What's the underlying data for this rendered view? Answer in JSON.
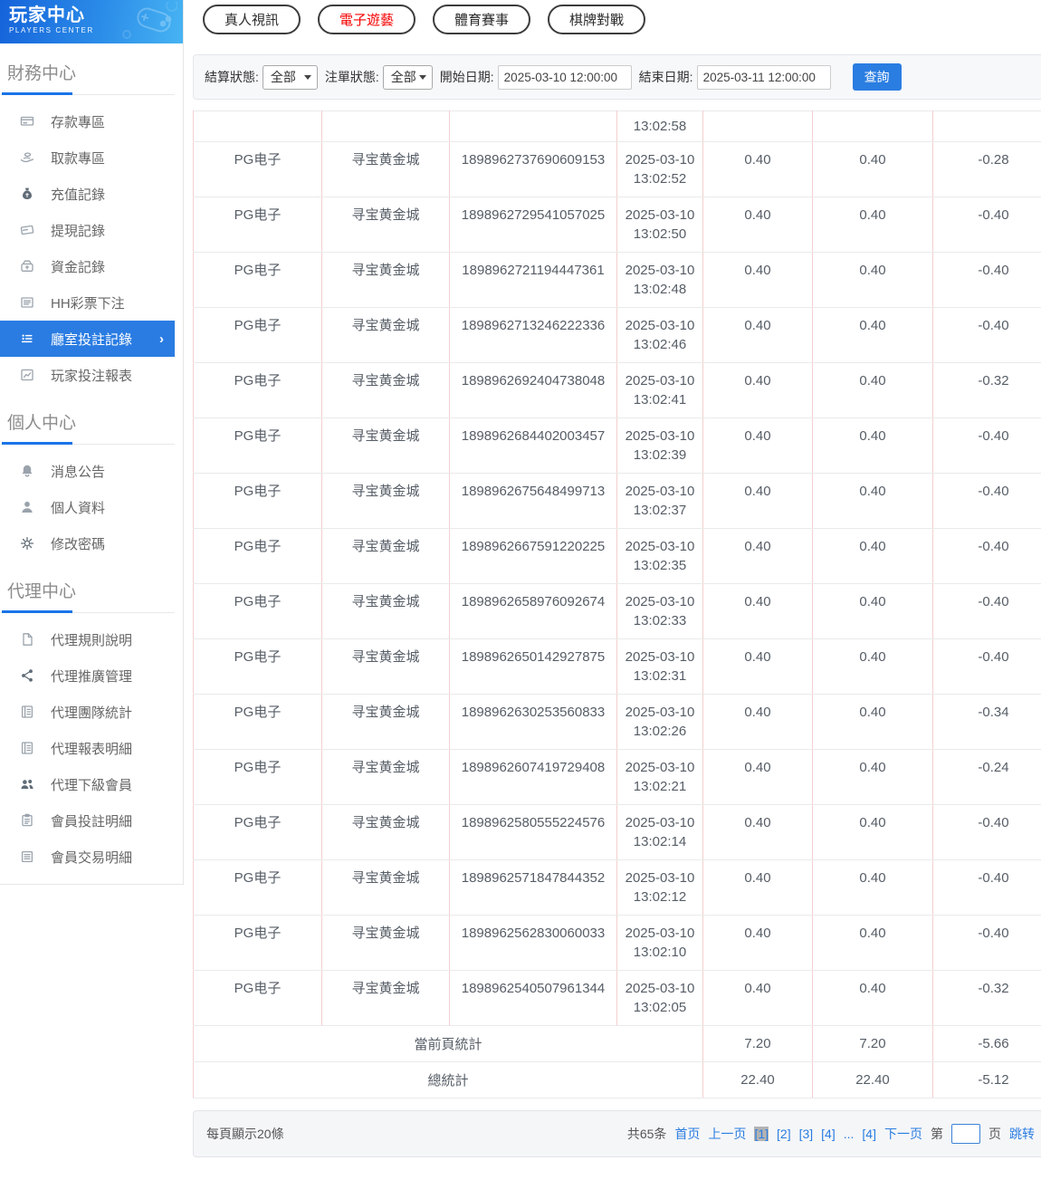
{
  "colors": {
    "accent_blue": "#2a7de1",
    "sidebar_selected_bg": "#2a7ce2",
    "active_tab_text": "#f50000",
    "table_vertical_border": "#f3cfcf",
    "table_horizontal_border": "#eaeaea",
    "current_page_bg": "#b3b3b3"
  },
  "sidebar": {
    "logo": {
      "title": "玩家中心",
      "subtitle": "PLAYERS CENTER"
    },
    "sections": [
      {
        "title": "財務中心",
        "items": [
          {
            "label": "存款專區",
            "icon": "deposit-icon",
            "selected": false
          },
          {
            "label": "取款專區",
            "icon": "withdraw-icon",
            "selected": false
          },
          {
            "label": "充值記錄",
            "icon": "recharge-record-icon",
            "selected": false
          },
          {
            "label": "提現記錄",
            "icon": "withdrawal-record-icon",
            "selected": false
          },
          {
            "label": "資金記錄",
            "icon": "funds-record-icon",
            "selected": false
          },
          {
            "label": "HH彩票下注",
            "icon": "lottery-bet-icon",
            "selected": false
          },
          {
            "label": "廳室投註記錄",
            "icon": "hall-bet-record-icon",
            "selected": true
          },
          {
            "label": "玩家投注報表",
            "icon": "player-bet-report-icon",
            "selected": false
          }
        ]
      },
      {
        "title": "個人中心",
        "items": [
          {
            "label": "消息公告",
            "icon": "notice-icon",
            "selected": false
          },
          {
            "label": "個人資料",
            "icon": "profile-icon",
            "selected": false
          },
          {
            "label": "修改密碼",
            "icon": "password-icon",
            "selected": false
          }
        ]
      },
      {
        "title": "代理中心",
        "items": [
          {
            "label": "代理規則說明",
            "icon": "agent-rules-icon",
            "selected": false
          },
          {
            "label": "代理推廣管理",
            "icon": "agent-promotion-icon",
            "selected": false
          },
          {
            "label": "代理團隊統計",
            "icon": "agent-team-stats-icon",
            "selected": false
          },
          {
            "label": "代理報表明細",
            "icon": "agent-report-detail-icon",
            "selected": false
          },
          {
            "label": "代理下級會員",
            "icon": "agent-sub-members-icon",
            "selected": false
          },
          {
            "label": "會員投註明細",
            "icon": "member-bet-detail-icon",
            "selected": false
          },
          {
            "label": "會員交易明細",
            "icon": "member-transaction-detail-icon",
            "selected": false
          }
        ]
      }
    ]
  },
  "tabs": [
    {
      "label": "真人視訊",
      "active": false
    },
    {
      "label": "電子遊藝",
      "active": true
    },
    {
      "label": "體育賽事",
      "active": false
    },
    {
      "label": "棋牌對戰",
      "active": false
    }
  ],
  "filters": {
    "settle_status_label": "結算狀態:",
    "settle_status_value": "全部",
    "order_status_label": "注單狀態:",
    "order_status_value": "全部",
    "start_date_label": "開始日期:",
    "start_date_value": "2025-03-10 12:00:00",
    "end_date_label": "結束日期:",
    "end_date_value": "2025-03-11 12:00:00",
    "search_label": "查詢"
  },
  "table": {
    "partial_row_time": "13:02:58",
    "rows": [
      {
        "platform": "PG电子",
        "game": "寻宝黄金城",
        "order_id": "1898962737690609153",
        "date": "2025-03-10",
        "time": "13:02:52",
        "bet": "0.40",
        "valid": "0.40",
        "profit": "-0.28"
      },
      {
        "platform": "PG电子",
        "game": "寻宝黄金城",
        "order_id": "1898962729541057025",
        "date": "2025-03-10",
        "time": "13:02:50",
        "bet": "0.40",
        "valid": "0.40",
        "profit": "-0.40"
      },
      {
        "platform": "PG电子",
        "game": "寻宝黄金城",
        "order_id": "1898962721194447361",
        "date": "2025-03-10",
        "time": "13:02:48",
        "bet": "0.40",
        "valid": "0.40",
        "profit": "-0.40"
      },
      {
        "platform": "PG电子",
        "game": "寻宝黄金城",
        "order_id": "1898962713246222336",
        "date": "2025-03-10",
        "time": "13:02:46",
        "bet": "0.40",
        "valid": "0.40",
        "profit": "-0.40"
      },
      {
        "platform": "PG电子",
        "game": "寻宝黄金城",
        "order_id": "1898962692404738048",
        "date": "2025-03-10",
        "time": "13:02:41",
        "bet": "0.40",
        "valid": "0.40",
        "profit": "-0.32"
      },
      {
        "platform": "PG电子",
        "game": "寻宝黄金城",
        "order_id": "1898962684402003457",
        "date": "2025-03-10",
        "time": "13:02:39",
        "bet": "0.40",
        "valid": "0.40",
        "profit": "-0.40"
      },
      {
        "platform": "PG电子",
        "game": "寻宝黄金城",
        "order_id": "1898962675648499713",
        "date": "2025-03-10",
        "time": "13:02:37",
        "bet": "0.40",
        "valid": "0.40",
        "profit": "-0.40"
      },
      {
        "platform": "PG电子",
        "game": "寻宝黄金城",
        "order_id": "1898962667591220225",
        "date": "2025-03-10",
        "time": "13:02:35",
        "bet": "0.40",
        "valid": "0.40",
        "profit": "-0.40"
      },
      {
        "platform": "PG电子",
        "game": "寻宝黄金城",
        "order_id": "1898962658976092674",
        "date": "2025-03-10",
        "time": "13:02:33",
        "bet": "0.40",
        "valid": "0.40",
        "profit": "-0.40"
      },
      {
        "platform": "PG电子",
        "game": "寻宝黄金城",
        "order_id": "1898962650142927875",
        "date": "2025-03-10",
        "time": "13:02:31",
        "bet": "0.40",
        "valid": "0.40",
        "profit": "-0.40"
      },
      {
        "platform": "PG电子",
        "game": "寻宝黄金城",
        "order_id": "1898962630253560833",
        "date": "2025-03-10",
        "time": "13:02:26",
        "bet": "0.40",
        "valid": "0.40",
        "profit": "-0.34"
      },
      {
        "platform": "PG电子",
        "game": "寻宝黄金城",
        "order_id": "1898962607419729408",
        "date": "2025-03-10",
        "time": "13:02:21",
        "bet": "0.40",
        "valid": "0.40",
        "profit": "-0.24"
      },
      {
        "platform": "PG电子",
        "game": "寻宝黄金城",
        "order_id": "1898962580555224576",
        "date": "2025-03-10",
        "time": "13:02:14",
        "bet": "0.40",
        "valid": "0.40",
        "profit": "-0.40"
      },
      {
        "platform": "PG电子",
        "game": "寻宝黄金城",
        "order_id": "1898962571847844352",
        "date": "2025-03-10",
        "time": "13:02:12",
        "bet": "0.40",
        "valid": "0.40",
        "profit": "-0.40"
      },
      {
        "platform": "PG电子",
        "game": "寻宝黄金城",
        "order_id": "1898962562830060033",
        "date": "2025-03-10",
        "time": "13:02:10",
        "bet": "0.40",
        "valid": "0.40",
        "profit": "-0.40"
      },
      {
        "platform": "PG电子",
        "game": "寻宝黄金城",
        "order_id": "1898962540507961344",
        "date": "2025-03-10",
        "time": "13:02:05",
        "bet": "0.40",
        "valid": "0.40",
        "profit": "-0.32"
      }
    ],
    "page_summary": {
      "label": "當前頁統計",
      "bet": "7.20",
      "valid": "7.20",
      "profit": "-5.66"
    },
    "total_summary": {
      "label": "總統計",
      "bet": "22.40",
      "valid": "22.40",
      "profit": "-5.12"
    }
  },
  "pagination": {
    "per_page_text": "每頁顯示20條",
    "total_text": "共65条",
    "first": "首页",
    "prev": "上一页",
    "pages": [
      {
        "label": "[1]",
        "current": true
      },
      {
        "label": "[2]",
        "current": false
      },
      {
        "label": "[3]",
        "current": false
      },
      {
        "label": "[4]",
        "current": false
      },
      {
        "label": "...",
        "current": false
      },
      {
        "label": "[4]",
        "current": false
      }
    ],
    "next": "下一页",
    "jump_prefix": "第",
    "jump_value": "",
    "jump_suffix": "页",
    "jump_label": "跳转"
  }
}
